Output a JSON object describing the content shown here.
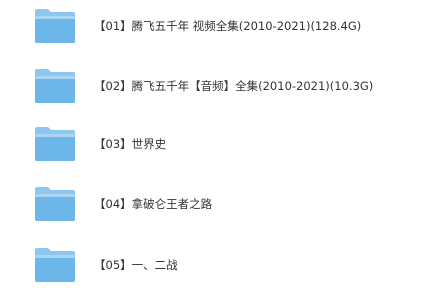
{
  "folders": [
    {
      "label": "【01】腾飞五千年 视频全集(2010-2021)(128.4G)",
      "icon": "folder-icon"
    },
    {
      "label": "【02】腾飞五千年【音频】全集(2010-2021)(10.3G)",
      "icon": "folder-icon"
    },
    {
      "label": "【03】世界史",
      "icon": "folder-icon"
    },
    {
      "label": "【04】拿破仑王者之路",
      "icon": "folder-icon"
    },
    {
      "label": "【05】一、二战",
      "icon": "folder-icon"
    }
  ],
  "colors": {
    "folder_back": "#8ec6ee",
    "folder_front": "#6cb6ea",
    "folder_edge": "#5aa6de",
    "text": "#333333"
  }
}
